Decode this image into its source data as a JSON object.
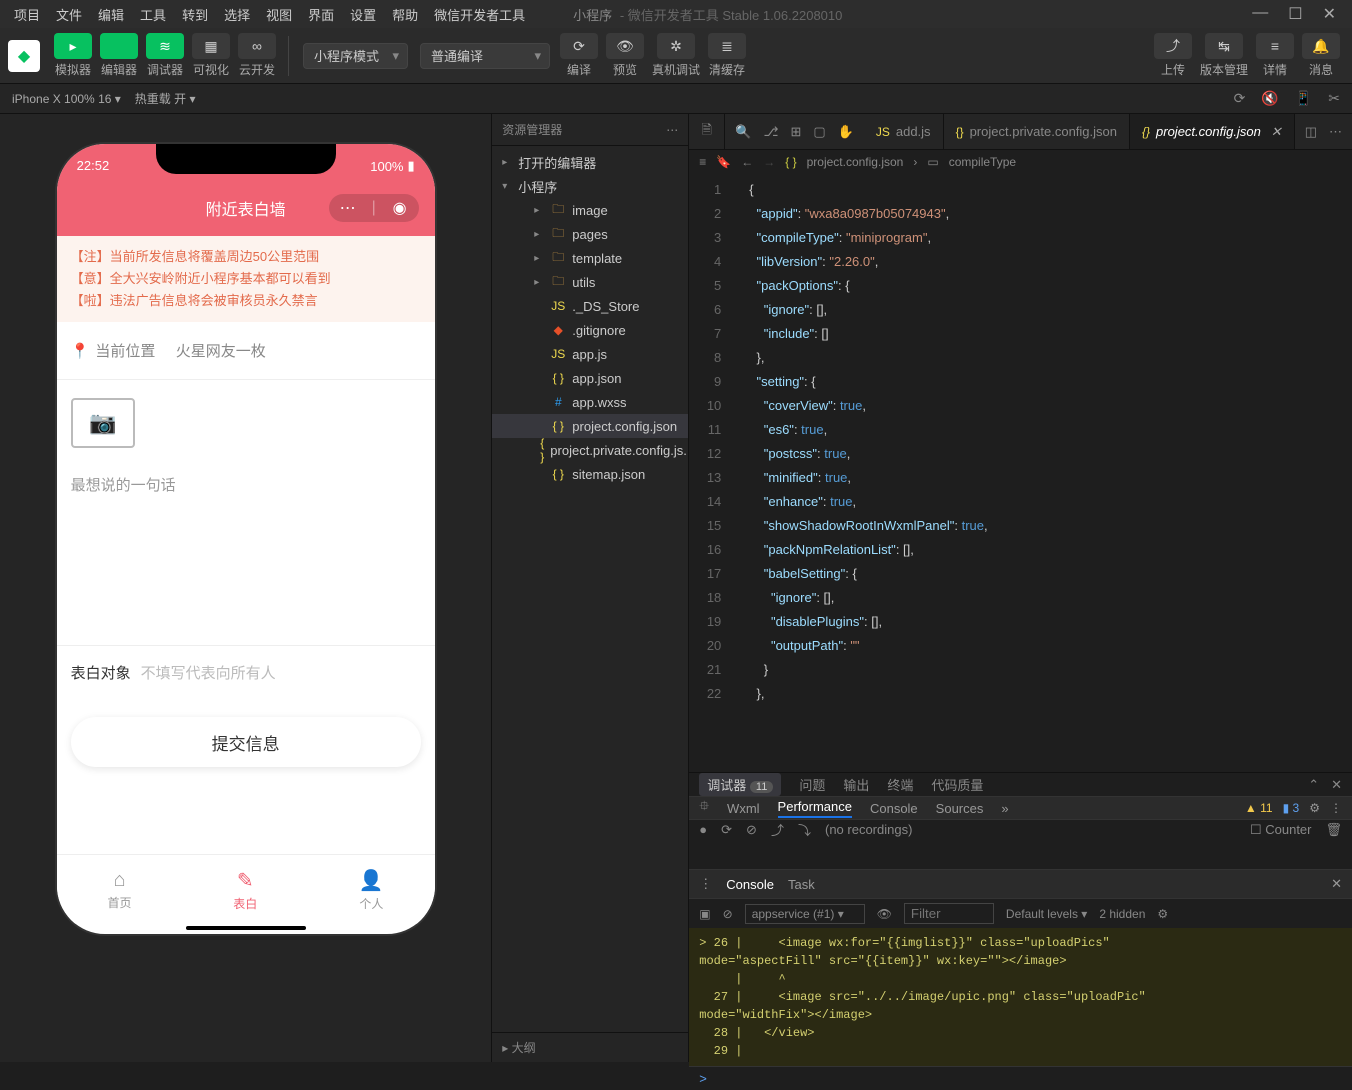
{
  "menu": {
    "items": [
      "项目",
      "文件",
      "编辑",
      "工具",
      "转到",
      "选择",
      "视图",
      "界面",
      "设置",
      "帮助",
      "微信开发者工具"
    ],
    "title": "小程序",
    "subtitle": "- 微信开发者工具 Stable 1.06.2208010"
  },
  "toolbar": {
    "left": [
      {
        "icon": "▸",
        "label": "模拟器",
        "green": true
      },
      {
        "icon": "</>",
        "label": "编辑器",
        "green": true
      },
      {
        "icon": "≋",
        "label": "调试器",
        "green": true
      },
      {
        "icon": "▦",
        "label": "可视化",
        "green": false
      },
      {
        "icon": "∞",
        "label": "云开发",
        "green": false
      }
    ],
    "mode_sel": "小程序模式",
    "compile_sel": "普通编译",
    "mid": [
      {
        "icon": "⟳",
        "label": "编译"
      },
      {
        "icon": "👁",
        "label": "预览"
      },
      {
        "icon": "✲",
        "label": "真机调试"
      },
      {
        "icon": "≣",
        "label": "清缓存"
      }
    ],
    "right": [
      {
        "icon": "⤴",
        "label": "上传"
      },
      {
        "icon": "↹",
        "label": "版本管理"
      },
      {
        "icon": "≡",
        "label": "详情"
      },
      {
        "icon": "🔔",
        "label": "消息"
      }
    ]
  },
  "devbar": {
    "device": "iPhone X 100% 16 ▾",
    "reload": "热重载 开 ▾"
  },
  "phone": {
    "time": "22:52",
    "battery": "100%",
    "title": "附近表白墙",
    "notices": [
      "【注】当前所发信息将覆盖周边50公里范围",
      "【意】全大兴安岭附近小程序基本都可以看到",
      "【啦】违法广告信息将会被审核员永久禁言"
    ],
    "loc_label": "当前位置",
    "loc_val": "火星网友一枚",
    "msg_placeholder": "最想说的一句话",
    "target_label": "表白对象",
    "target_ph": "不填写代表向所有人",
    "submit": "提交信息",
    "tabs": [
      {
        "icon": "⌂",
        "label": "首页"
      },
      {
        "icon": "✎",
        "label": "表白"
      },
      {
        "icon": "👤",
        "label": "个人"
      }
    ]
  },
  "explorer": {
    "title": "资源管理器",
    "groups": [
      {
        "label": "打开的编辑器",
        "open": false
      },
      {
        "label": "小程序",
        "open": true
      }
    ],
    "tree": [
      {
        "t": "folder",
        "name": "image"
      },
      {
        "t": "folder",
        "name": "pages"
      },
      {
        "t": "folder",
        "name": "template"
      },
      {
        "t": "folder",
        "name": "utils"
      },
      {
        "t": "file",
        "name": "._DS_Store",
        "cls": "js"
      },
      {
        "t": "file",
        "name": ".gitignore",
        "cls": "git"
      },
      {
        "t": "file",
        "name": "app.js",
        "cls": "js"
      },
      {
        "t": "file",
        "name": "app.json",
        "cls": "json"
      },
      {
        "t": "file",
        "name": "app.wxss",
        "cls": "css"
      },
      {
        "t": "file",
        "name": "project.config.json",
        "cls": "json",
        "sel": true
      },
      {
        "t": "file",
        "name": "project.private.config.js...",
        "cls": "json"
      },
      {
        "t": "file",
        "name": "sitemap.json",
        "cls": "json"
      }
    ],
    "outline": "大纲"
  },
  "tabs": [
    {
      "icon": "JS",
      "label": "add.js",
      "cls": "js"
    },
    {
      "icon": "{}",
      "label": "project.private.config.json",
      "cls": "json"
    },
    {
      "icon": "{}",
      "label": "project.config.json",
      "cls": "json",
      "active": true
    }
  ],
  "breadcrumb": {
    "file": "project.config.json",
    "sym": "compileType"
  },
  "code": {
    "lines": [
      {
        "n": 1,
        "t": "{"
      },
      {
        "n": 2,
        "t": "  \"appid\": \"wxa8a0987b05074943\","
      },
      {
        "n": 3,
        "t": "  \"compileType\": \"miniprogram\","
      },
      {
        "n": 4,
        "t": "  \"libVersion\": \"2.26.0\","
      },
      {
        "n": 5,
        "t": "  \"packOptions\": {"
      },
      {
        "n": 6,
        "t": "    \"ignore\": [],"
      },
      {
        "n": 7,
        "t": "    \"include\": []"
      },
      {
        "n": 8,
        "t": "  },"
      },
      {
        "n": 9,
        "t": "  \"setting\": {"
      },
      {
        "n": 10,
        "t": "    \"coverView\": true,"
      },
      {
        "n": 11,
        "t": "    \"es6\": true,"
      },
      {
        "n": 12,
        "t": "    \"postcss\": true,"
      },
      {
        "n": 13,
        "t": "    \"minified\": true,"
      },
      {
        "n": 14,
        "t": "    \"enhance\": true,"
      },
      {
        "n": 15,
        "t": "    \"showShadowRootInWxmlPanel\": true,"
      },
      {
        "n": 16,
        "t": "    \"packNpmRelationList\": [],"
      },
      {
        "n": 17,
        "t": "    \"babelSetting\": {"
      },
      {
        "n": 18,
        "t": "      \"ignore\": [],"
      },
      {
        "n": 19,
        "t": "      \"disablePlugins\": [],"
      },
      {
        "n": 20,
        "t": "      \"outputPath\": \"\""
      },
      {
        "n": 21,
        "t": "    }"
      },
      {
        "n": 22,
        "t": "  },"
      }
    ]
  },
  "debug": {
    "tabs": [
      "调试器",
      "问题",
      "输出",
      "终端",
      "代码质量"
    ],
    "badge": "11",
    "devtabs": [
      "Wxml",
      "Performance",
      "Console",
      "Sources"
    ],
    "warn_count": "11",
    "info_count": "3",
    "perf_rec": "(no recordings)",
    "perf_counter": "Counter",
    "console_tabs": [
      "Console",
      "Task"
    ],
    "ctx": "appservice (#1)",
    "filter_ph": "Filter",
    "levels": "Default levels ▾",
    "hidden": "2 hidden",
    "lines": [
      "> 26 |     <image wx:for=\"{{imglist}}\" class=\"uploadPics\"",
      "mode=\"aspectFill\" src=\"{{item}}\" wx:key=\"\"></image>",
      "     |     ^",
      "  27 |     <image src=\"../../image/upic.png\" class=\"uploadPic\"",
      "mode=\"widthFix\"></image>",
      "  28 |   </view>",
      "  29 |"
    ],
    "prompt": ">"
  }
}
